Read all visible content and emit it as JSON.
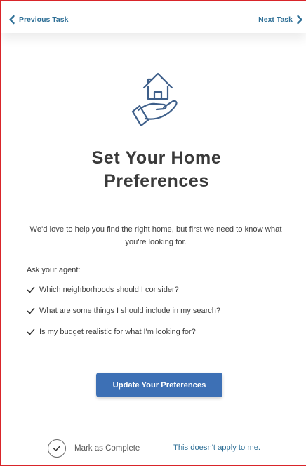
{
  "nav": {
    "previous_label": "Previous Task",
    "next_label": "Next Task",
    "link_color": "#2e6f96"
  },
  "task": {
    "icon": "house-in-hand-icon",
    "title_line1": "Set Your Home",
    "title_line2": "Preferences",
    "intro": "We'd love to help you find the right home, but first we need to know what you're looking for.",
    "ask_label": "Ask your agent:",
    "questions": [
      "Which neighborhoods should I consider?",
      "What are some things I should include in my search?",
      "Is my budget realistic for what I'm looking for?"
    ],
    "cta_label": "Update Your Preferences",
    "cta_color": "#3d70b5"
  },
  "footer": {
    "mark_complete_label": "Mark as Complete",
    "not_apply_label": "This doesn't apply to me."
  }
}
